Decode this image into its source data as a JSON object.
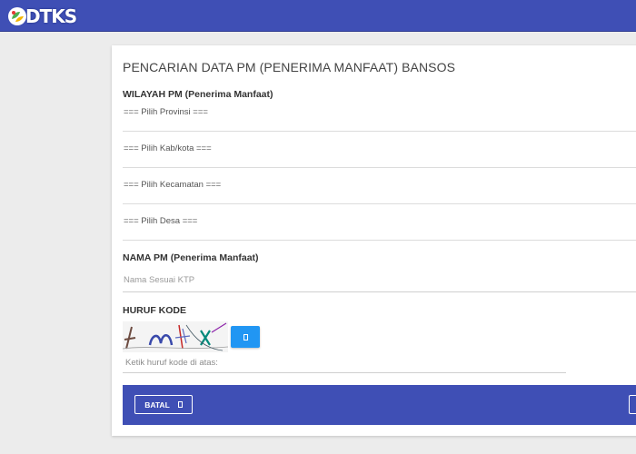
{
  "header": {
    "logo_text": "DTKS",
    "colors": {
      "bar": "#3f4fb5",
      "accent": "#2196f3"
    }
  },
  "form": {
    "title": "PENCARIAN DATA PM (PENERIMA MANFAAT) BANSOS",
    "wilayah_label": "WILAYAH PM (Penerima Manfaat)",
    "provinsi": "=== Pilih Provinsi ===",
    "kabkota": "=== Pilih Kab/kota ===",
    "kecamatan": "=== Pilih Kecamatan ===",
    "desa": "=== Pilih Desa ===",
    "nama_label": "NAMA PM (Penerima Manfaat)",
    "nama_placeholder": "Nama Sesuai KTP",
    "kode_label": "HURUF KODE",
    "kode_placeholder": "Ketik huruf kode di atas:",
    "refresh_icon": "refresh-icon"
  },
  "footer": {
    "cancel_label": "BATAL",
    "cancel_icon": "close-icon"
  }
}
